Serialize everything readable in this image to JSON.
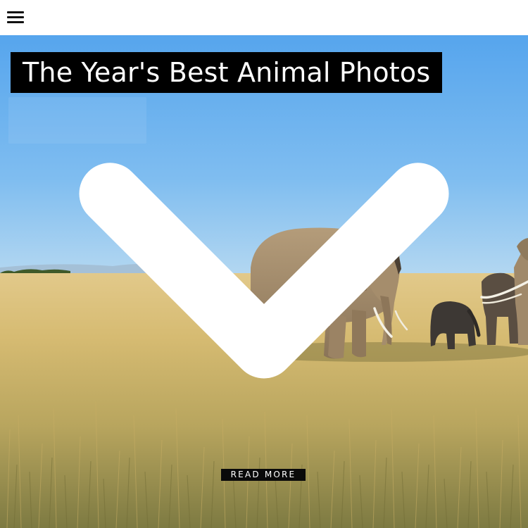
{
  "header": {
    "menu_icon": "hamburger-menu-icon"
  },
  "hero": {
    "title": "The Year's Best Animal Photos",
    "image_subject": "elephants-on-savanna",
    "read_more_label": "READ MORE",
    "scroll_icon": "chevron-down-icon"
  },
  "colors": {
    "sky_top": "#5aa7ec",
    "sky_bottom": "#a9d3f2",
    "grass_light": "#d9c07a",
    "grass_dark": "#8c8a4a",
    "title_bg": "#000000",
    "title_text": "#ffffff"
  }
}
